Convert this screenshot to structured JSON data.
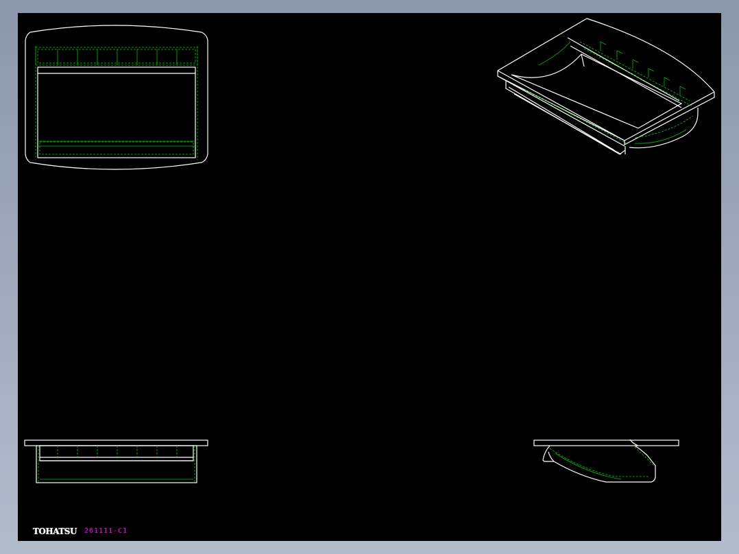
{
  "title_block": {
    "logo_text": "TOHATSU",
    "part_number": "261111-C1"
  },
  "colors": {
    "background": "#000000",
    "frame": "#9aa4b6",
    "outline": "#ffffff",
    "hidden_lines": "#00d000",
    "part_number": "#ff00ff"
  }
}
